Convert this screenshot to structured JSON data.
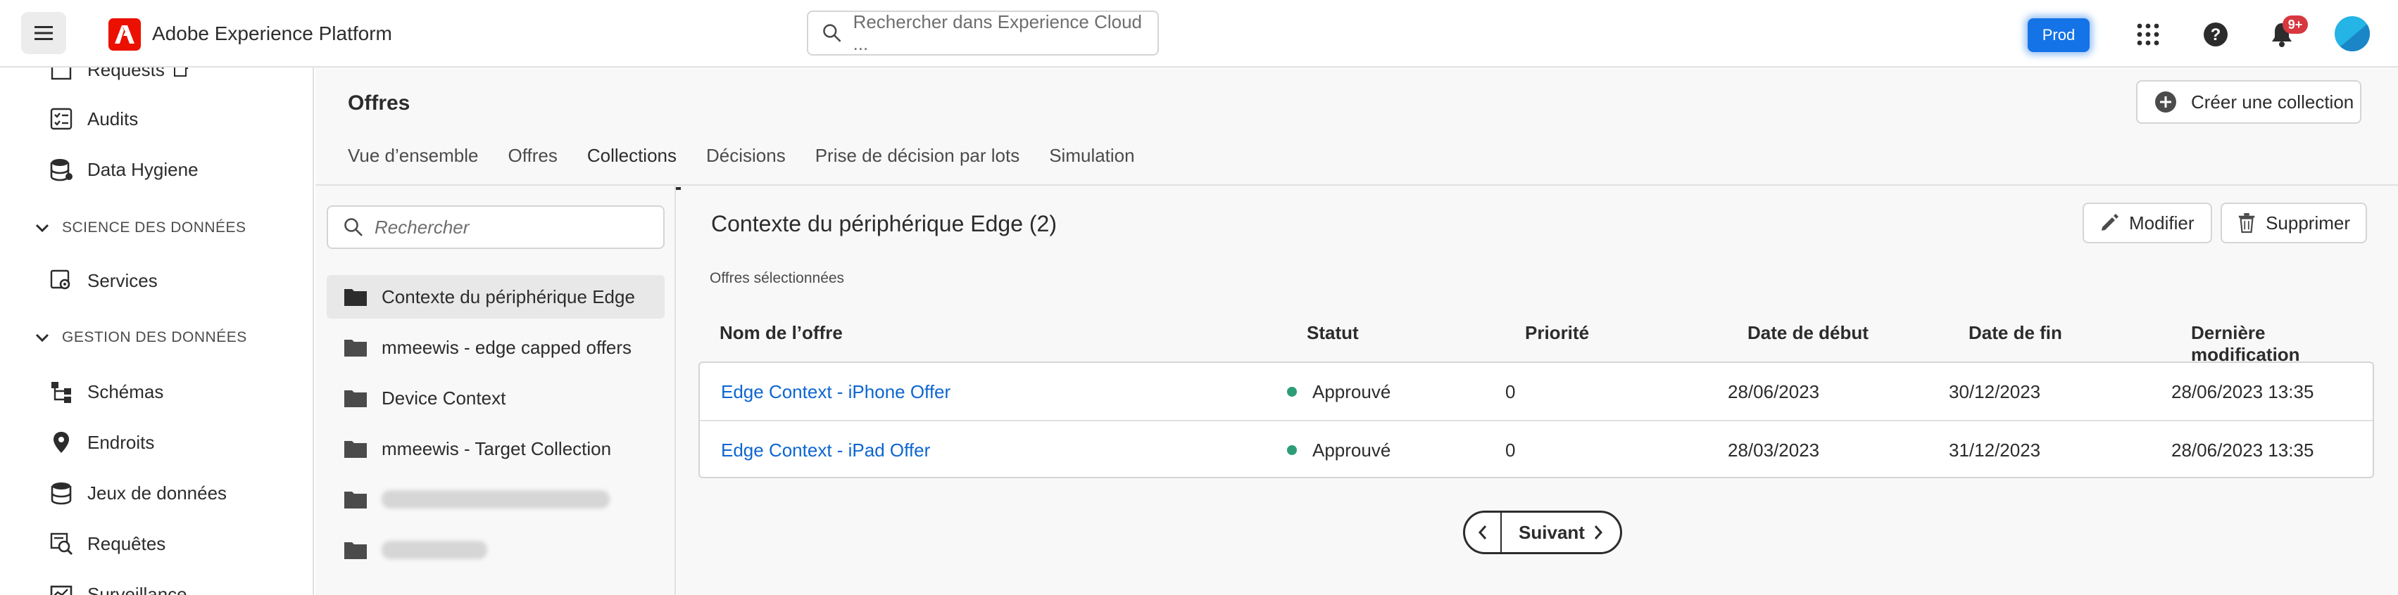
{
  "app": {
    "title": "Adobe Experience Platform",
    "environment": "Prod",
    "notifications_badge": "9+"
  },
  "search": {
    "placeholder": "Rechercher dans Experience Cloud ..."
  },
  "sidebar": {
    "items": [
      {
        "label": "Requests",
        "icon": "external-link-icon"
      },
      {
        "label": "Audits",
        "icon": "checklist-icon"
      },
      {
        "label": "Data Hygiene",
        "icon": "database-icon"
      },
      {
        "label": "Services",
        "icon": "gear-icon"
      },
      {
        "label": "Schémas",
        "icon": "schema-icon"
      },
      {
        "label": "Endroits",
        "icon": "location-pin-icon"
      },
      {
        "label": "Jeux de données",
        "icon": "database-icon"
      },
      {
        "label": "Requêtes",
        "icon": "query-icon"
      },
      {
        "label": "Surveillance",
        "icon": "monitor-icon"
      }
    ],
    "sections": [
      "SCIENCE DES DONNÉES",
      "GESTION DES DONNÉES"
    ]
  },
  "page": {
    "title": "Offres",
    "create_button": "Créer une collection",
    "tabs": [
      "Vue d’ensemble",
      "Offres",
      "Collections",
      "Décisions",
      "Prise de décision par lots",
      "Simulation"
    ],
    "active_tab": "Collections"
  },
  "collections": {
    "search_placeholder": "Rechercher",
    "items": [
      "Contexte du périphérique Edge",
      "mmeewis - edge capped offers",
      "Device Context",
      "mmeewis - Target Collection"
    ],
    "selected": "Contexte du périphérique Edge"
  },
  "detail": {
    "title": "Contexte du périphérique Edge (2)",
    "edit_label": "Modifier",
    "delete_label": "Supprimer",
    "subheading": "Offres sélectionnées",
    "columns": [
      "Nom de l’offre",
      "Statut",
      "Priorité",
      "Date de début",
      "Date de fin",
      "Dernière modification"
    ],
    "rows": [
      {
        "name": "Edge Context - iPhone Offer",
        "status": "Approuvé",
        "priority": "0",
        "start": "28/06/2023",
        "end": "30/12/2023",
        "modified": "28/06/2023 13:35"
      },
      {
        "name": "Edge Context - iPad Offer",
        "status": "Approuvé",
        "priority": "0",
        "start": "28/03/2023",
        "end": "31/12/2023",
        "modified": "28/06/2023 13:35"
      }
    ],
    "next_label": "Suivant"
  },
  "colors": {
    "accent": "#1473e6",
    "link": "#0d66d0",
    "status_approved": "#2d9d78",
    "brand": "#eb1000",
    "badge": "#d7373f"
  }
}
